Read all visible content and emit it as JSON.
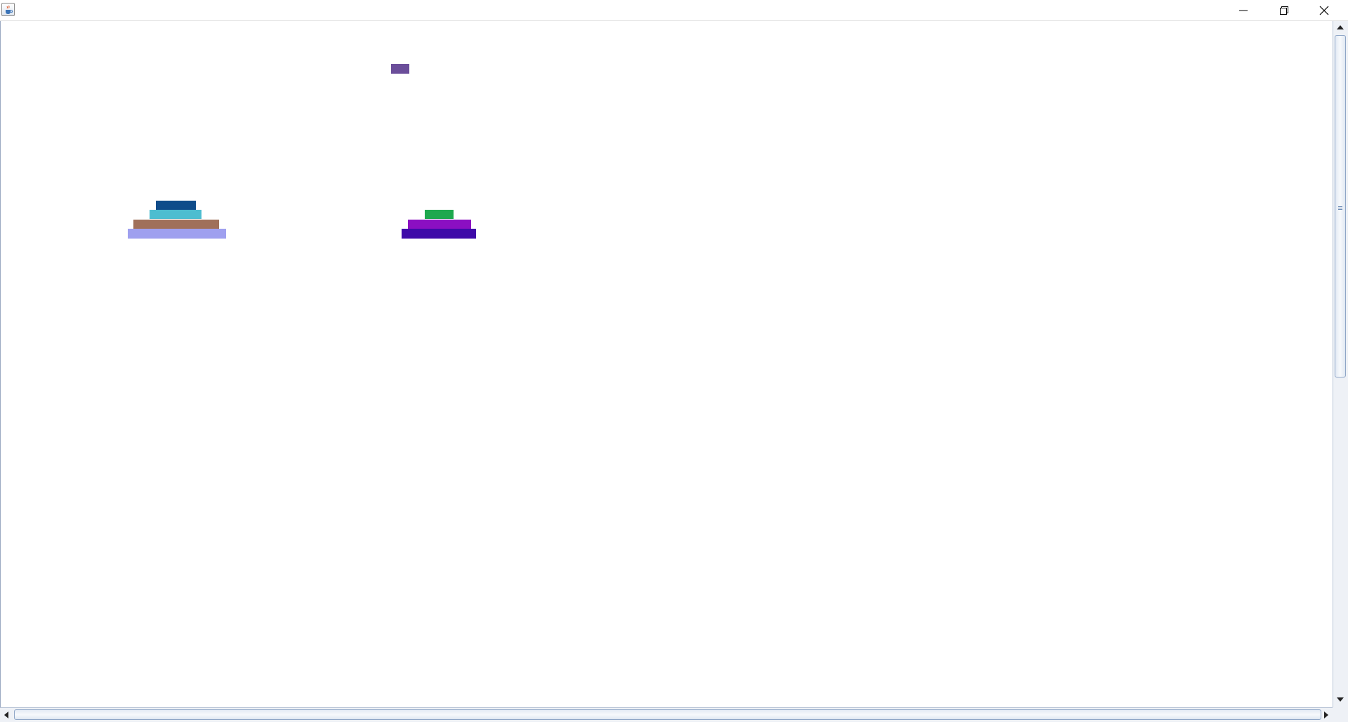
{
  "window": {
    "title": "",
    "icon": "java-cup-icon",
    "controls": [
      "minimize-icon",
      "restore-icon",
      "close-icon"
    ]
  },
  "game": {
    "towers": [
      {
        "name": "tower-left",
        "disks_top_to_bottom": [
          {
            "color": "#0f4c8a"
          },
          {
            "color": "#4dbdd0"
          },
          {
            "color": "#a0705a"
          },
          {
            "color": "#9fa0ef"
          }
        ]
      },
      {
        "name": "tower-middle",
        "disks_top_to_bottom": [
          {
            "color": "#1ea84e"
          },
          {
            "color": "#8b0fc2"
          },
          {
            "color": "#3e0aa8"
          }
        ]
      },
      {
        "name": "tower-right",
        "disks_top_to_bottom": []
      }
    ],
    "lifted_disk": {
      "color": "#6b4e9a"
    }
  },
  "scrollbars": {
    "vertical": {
      "icons": [
        "arrow-up-icon",
        "arrow-down-icon"
      ]
    },
    "horizontal": {
      "icons": [
        "arrow-left-icon",
        "arrow-right-icon"
      ]
    }
  }
}
